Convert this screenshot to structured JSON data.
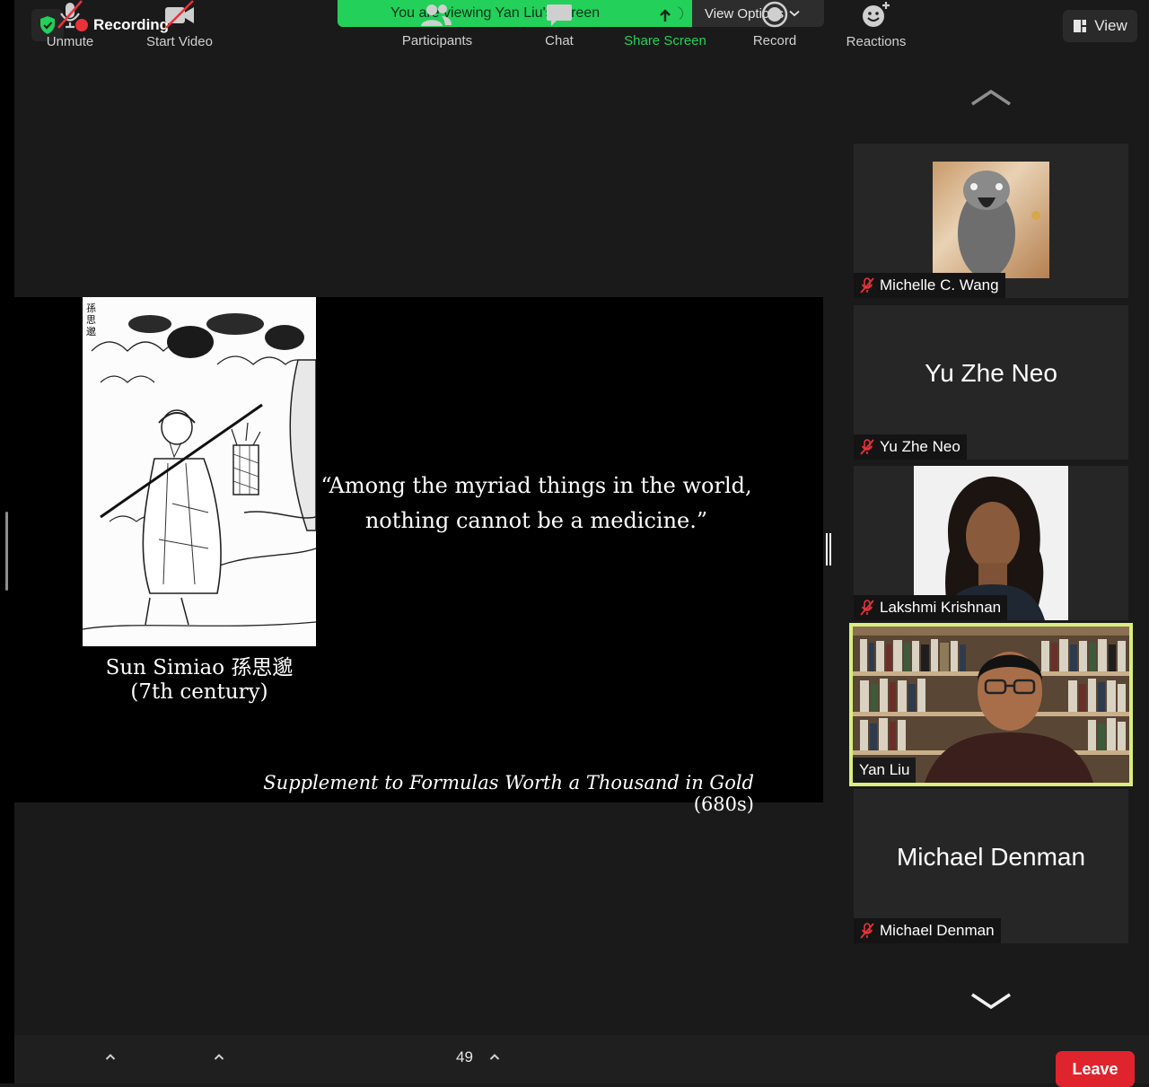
{
  "meeting": {
    "recording_label": "Recording",
    "banner_text": "You are viewing Yan Liu's screen",
    "view_options_label": "View Options",
    "view_label": "View"
  },
  "slide": {
    "portrait_chinese_label": "孫思邈",
    "caption_name": "Sun Simiao 孫思邈",
    "caption_date": "(7th century)",
    "quote_line1": "“Among the myriad things in the world,",
    "quote_line2": "nothing cannot be a medicine.”",
    "source_title": "Supplement to Formulas Worth a Thousand in Gold",
    "source_year": "(680s)"
  },
  "participants": [
    {
      "name": "Michelle C. Wang",
      "muted": true,
      "video": "photo-parrot"
    },
    {
      "name": "Yu Zhe Neo",
      "muted": true,
      "video": "none",
      "display_name": "Yu Zhe Neo"
    },
    {
      "name": "Lakshmi Krishnan",
      "muted": true,
      "video": "photo-portrait"
    },
    {
      "name": "Yan Liu",
      "muted": false,
      "video": "live",
      "active_speaker": true
    },
    {
      "name": "Michael Denman",
      "muted": true,
      "video": "none",
      "display_name": "Michael Denman"
    }
  ],
  "toolbar": {
    "unmute_label": "Unmute",
    "start_video_label": "Start Video",
    "participants_count": "49",
    "participants_label": "Participants",
    "chat_label": "Chat",
    "share_screen_label": "Share Screen",
    "record_label": "Record",
    "reactions_label": "Reactions",
    "leave_label": "Leave"
  },
  "colors": {
    "banner_green": "#23d05a",
    "record_red": "#e8323a",
    "leave_red": "#e0242d",
    "speaker_border": "#d9ee7e",
    "share_green": "#23d05a"
  }
}
